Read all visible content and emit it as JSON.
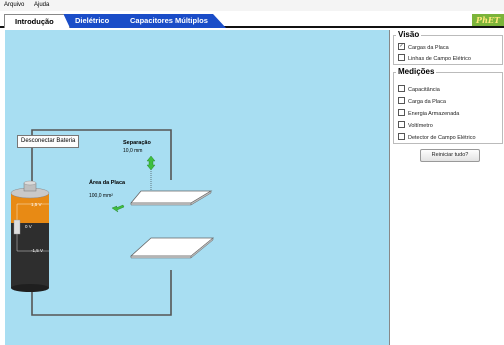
{
  "menu": {
    "file": "Arquivo",
    "help": "Ajuda"
  },
  "tabs": [
    {
      "label": "Introdução"
    },
    {
      "label": "Dielétrico"
    },
    {
      "label": "Capacitores Múltiplos"
    }
  ],
  "logo": "PhET",
  "sim": {
    "disconnect_button": "Desconectar Bateria",
    "separation_label": "Separação",
    "separation_value": "10,0 mm",
    "plate_area_label": "Área da Placa",
    "plate_area_value": "100,0 mm²",
    "battery_top": "1,5 V",
    "battery_mid": "0 V",
    "battery_bot": "-1,5 V"
  },
  "sidebar": {
    "view_title": "Visão",
    "view_items": [
      {
        "label": "Cargas da Placa",
        "checked": true
      },
      {
        "label": "Linhas de Campo Elétrico",
        "checked": false
      }
    ],
    "measurements_title": "Medições",
    "measurement_items": [
      {
        "label": "Capacitância",
        "checked": false
      },
      {
        "label": "Carga da Placa",
        "checked": false
      },
      {
        "label": "Energia Armazenada",
        "checked": false
      },
      {
        "label": "Voltímetro",
        "checked": false
      },
      {
        "label": "Detector de Campo Elétrico",
        "checked": false
      }
    ],
    "reset_button": "Reiniciar tudo?"
  },
  "colors": {
    "tab_blue": "#1a4dc8",
    "play_bg": "#a8def2",
    "battery_orange": "#e88a14",
    "arrow_green": "#3fbf3f"
  }
}
